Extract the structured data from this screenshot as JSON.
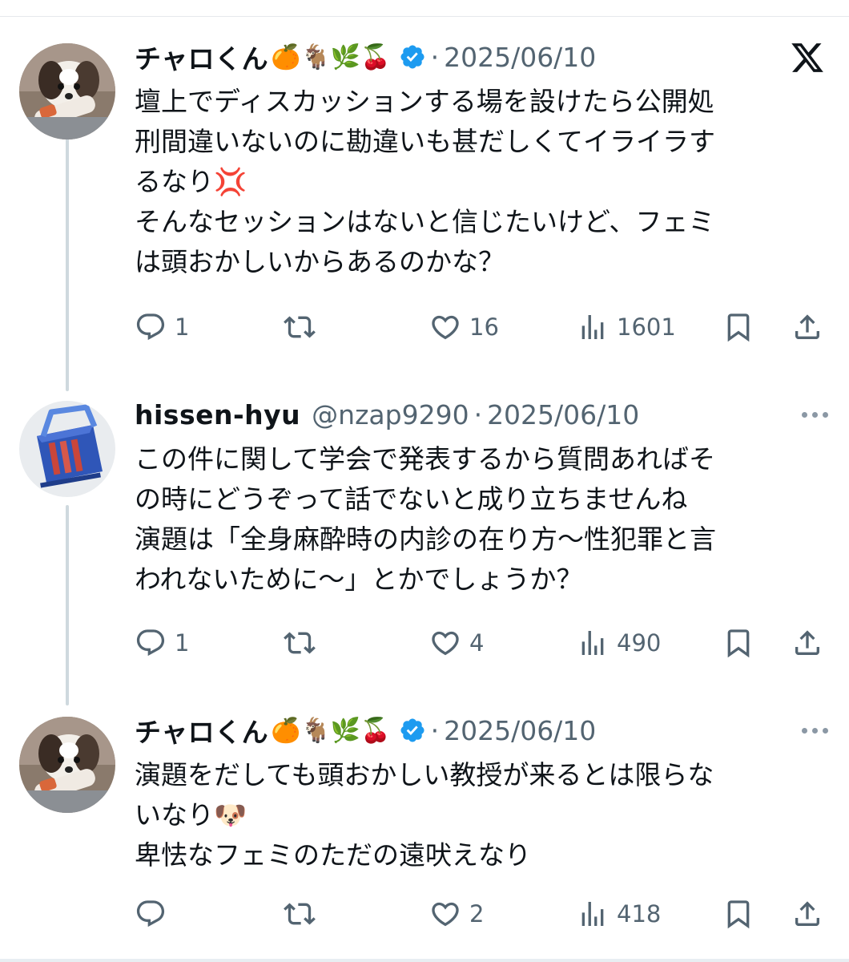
{
  "platform_logo": "x-logo-icon",
  "tweets": [
    {
      "name": "チャロくん",
      "name_emojis": "🍊🐐🌿🍒",
      "verified": true,
      "handle": "",
      "dot": "·",
      "date": "2025/06/10",
      "lines": [
        "壇上でディスカッションする場を設けたら公開処",
        "刑間違いないのに勘違いも甚だしくてイライラす",
        "るなり💢",
        "そんなセッションはないと信じたいけど、フェミ",
        "は頭おかしいからあるのかな？"
      ],
      "replies": "1",
      "retweets": "",
      "likes": "16",
      "views": "1601"
    },
    {
      "name": "hissen-hyu",
      "name_emojis": "",
      "verified": false,
      "handle": "@nzap9290",
      "dot": "·",
      "date": "2025/06/10",
      "lines": [
        "この件に関して学会で発表するから質問あればそ",
        "の時にどうぞって話でないと成り立ちませんね",
        "演題は「全身麻酔時の内診の在り方〜性犯罪と言",
        "われないために〜」とかでしょうか？"
      ],
      "replies": "1",
      "retweets": "",
      "likes": "4",
      "views": "490"
    },
    {
      "name": "チャロくん",
      "name_emojis": "🍊🐐🌿🍒",
      "verified": true,
      "handle": "",
      "dot": "·",
      "date": "2025/06/10",
      "lines": [
        "演題をだしても頭おかしい教授が来るとは限らな",
        "いなり🐶",
        "卑怯なフェミのただの遠吠えなり"
      ],
      "replies": "",
      "retweets": "",
      "likes": "2",
      "views": "418"
    }
  ],
  "colors": {
    "text": "#0f1419",
    "secondary": "#536471",
    "verified": "#1d9bf0",
    "thread_line": "#cfd9de"
  }
}
